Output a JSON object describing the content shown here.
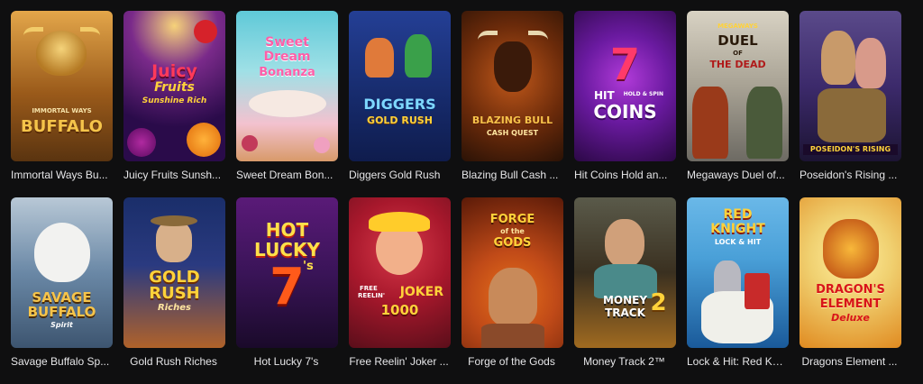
{
  "games": [
    {
      "title": "Immortal Ways Bu...",
      "colors": [
        "#8a5a1f",
        "#c9923a"
      ],
      "icon": "buffalo-icon"
    },
    {
      "title": "Juicy Fruits Sunsh...",
      "colors": [
        "#2a0b4a",
        "#1a0630"
      ],
      "icon": "fruit-icon"
    },
    {
      "title": "Sweet Dream Bon...",
      "colors": [
        "#5fc9d8",
        "#f3b8c8"
      ],
      "icon": "candy-icon"
    },
    {
      "title": "Diggers Gold Rush",
      "colors": [
        "#1d3a8a",
        "#0f1c4d"
      ],
      "icon": "digger-icon"
    },
    {
      "title": "Blazing Bull Cash ...",
      "colors": [
        "#3a1a08",
        "#8a3a10"
      ],
      "icon": "bull-icon"
    },
    {
      "title": "Hit Coins Hold an...",
      "colors": [
        "#6a1aa0",
        "#2b0845"
      ],
      "icon": "seven-icon"
    },
    {
      "title": "Megaways Duel of...",
      "colors": [
        "#c9c2b3",
        "#6d6a63"
      ],
      "icon": "cowboy-icon"
    },
    {
      "title": "Poseidon's Rising ...",
      "colors": [
        "#3c2a6b",
        "#1c1433"
      ],
      "icon": "poseidon-icon"
    },
    {
      "title": "Savage Buffalo Sp...",
      "colors": [
        "#8fb0c8",
        "#3d5570"
      ],
      "icon": "white-buffalo-icon"
    },
    {
      "title": "Gold Rush Riches",
      "colors": [
        "#1a2e6a",
        "#b0622a"
      ],
      "icon": "miner-icon"
    },
    {
      "title": "Hot Lucky 7's",
      "colors": [
        "#3a1458",
        "#1a0a2a"
      ],
      "icon": "seven-icon"
    },
    {
      "title": "Free Reelin' Joker ...",
      "colors": [
        "#5a0e1a",
        "#a8182c"
      ],
      "icon": "joker-icon"
    },
    {
      "title": "Forge of the Gods",
      "colors": [
        "#7a2a10",
        "#c04a18"
      ],
      "icon": "warrior-icon"
    },
    {
      "title": "Money Track 2™",
      "colors": [
        "#3a3020",
        "#a06a20"
      ],
      "icon": "robber-icon"
    },
    {
      "title": "Lock & Hit: Red Kn...",
      "colors": [
        "#4aa0d8",
        "#1a5a9a"
      ],
      "icon": "knight-icon"
    },
    {
      "title": "Dragons Element ...",
      "colors": [
        "#f0d070",
        "#e08a20"
      ],
      "icon": "dragon-icon"
    }
  ],
  "logos": [
    {
      "lines": [
        "IMMORTAL WAYS",
        "BUFFALO"
      ]
    },
    {
      "lines": [
        "Juicy",
        "Fruits",
        "Sunshine Rich"
      ]
    },
    {
      "lines": [
        "Sweet",
        "Dream",
        "Bonanza"
      ]
    },
    {
      "lines": [
        "DIGGERS",
        "GOLD RUSH"
      ]
    },
    {
      "lines": [
        "BLAZING BULL",
        "CASH QUEST"
      ]
    },
    {
      "lines": [
        "7",
        "HIT",
        "HOLD & SPIN",
        "COINS"
      ]
    },
    {
      "lines": [
        "MEGAWAYS",
        "DUEL",
        "OF",
        "THE DEAD"
      ]
    },
    {
      "lines": [
        "POSEIDON'S RISING"
      ]
    },
    {
      "lines": [
        "SAVAGE",
        "BUFFALO",
        "Spirit"
      ]
    },
    {
      "lines": [
        "GOLD",
        "RUSH",
        "Riches"
      ]
    },
    {
      "lines": [
        "HOT",
        "LUCKY",
        "7",
        "'s"
      ]
    },
    {
      "lines": [
        "FREE",
        "REELIN'",
        "JOKER",
        "1000"
      ]
    },
    {
      "lines": [
        "FORGE",
        "of the",
        "GODS"
      ]
    },
    {
      "lines": [
        "MONEY",
        "TRACK",
        "2"
      ]
    },
    {
      "lines": [
        "RED",
        "KNIGHT",
        "LOCK & HIT"
      ]
    },
    {
      "lines": [
        "DRAGON'S",
        "ELEMENT",
        "Deluxe"
      ]
    }
  ]
}
